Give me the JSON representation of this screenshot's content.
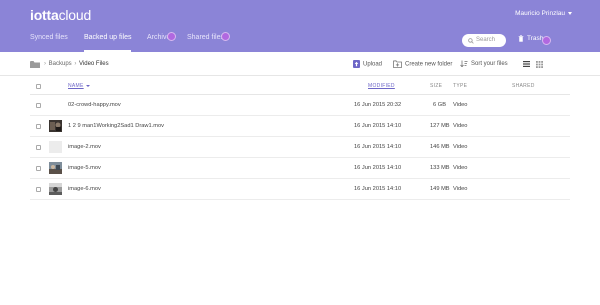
{
  "header": {
    "logo_bold": "iotta",
    "logo_light": "cloud",
    "user_name": "Mauricio Prinzlau"
  },
  "tabs": [
    {
      "label": "Synced files",
      "active": false
    },
    {
      "label": "Backed up files",
      "active": true
    },
    {
      "label": "Archive",
      "active": false
    },
    {
      "label": "Shared files",
      "active": false
    }
  ],
  "search": {
    "placeholder": "Search"
  },
  "trash": {
    "label": "Trash"
  },
  "breadcrumb": {
    "root": "Backups",
    "current": "Video Files",
    "separator": "›"
  },
  "toolbar": {
    "upload_label": "Upload",
    "create_folder_label": "Create new folder",
    "sort_label": "Sort your files"
  },
  "table": {
    "columns": {
      "name": "NAME",
      "modified": "MODIFIED",
      "size": "SIZE",
      "type": "TYPE",
      "shared": "SHARED"
    },
    "rows": [
      {
        "name": "02-crowd-happy.mov",
        "modified": "16 Jun 2015 20:32",
        "size": "6 GB",
        "type": "Video",
        "thumb": "none"
      },
      {
        "name": "1 2 9 man1Working2Sad1 Draw1.mov",
        "modified": "16 Jun 2015 14:10",
        "size": "127 MB",
        "type": "Video",
        "thumb": "dark"
      },
      {
        "name": "image-2.mov",
        "modified": "16 Jun 2015 14:10",
        "size": "146 MB",
        "type": "Video",
        "thumb": "blank"
      },
      {
        "name": "image-5.mov",
        "modified": "16 Jun 2015 14:10",
        "size": "133 MB",
        "type": "Video",
        "thumb": "photo"
      },
      {
        "name": "image-6.mov",
        "modified": "16 Jun 2015 14:10",
        "size": "149 MB",
        "type": "Video",
        "thumb": "bw"
      }
    ]
  },
  "colors": {
    "header": "#8b84d7",
    "accent": "#6d66c7",
    "notification_dot": "#b168e0"
  }
}
